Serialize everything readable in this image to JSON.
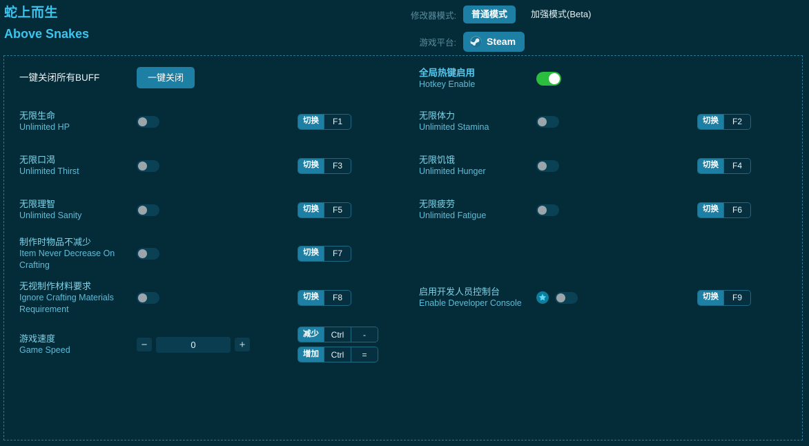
{
  "header": {
    "title_cn": "蛇上而生",
    "title_en": "Above Snakes",
    "mode_label": "修改器模式:",
    "mode_normal": "普通模式",
    "mode_enhanced": "加强模式(Beta)",
    "platform_label": "游戏平台:",
    "platform_value": "Steam",
    "platform_icon": "steam-icon"
  },
  "top_row": {
    "left_label_cn": "一键关闭所有BUFF",
    "close_all_button": "一键关闭",
    "hotkey_cn": "全局热键启用",
    "hotkey_en": "Hotkey Enable",
    "hotkey_state": "on"
  },
  "left_column": [
    {
      "cn": "无限生命",
      "en": "Unlimited HP",
      "toggle": "off",
      "hotkeys": [
        {
          "action": "切换",
          "keys": [
            "F1"
          ]
        }
      ]
    },
    {
      "cn": "无限口渴",
      "en": "Unlimited Thirst",
      "toggle": "off",
      "hotkeys": [
        {
          "action": "切换",
          "keys": [
            "F3"
          ]
        }
      ]
    },
    {
      "cn": "无限理智",
      "en": "Unlimited Sanity",
      "toggle": "off",
      "hotkeys": [
        {
          "action": "切换",
          "keys": [
            "F5"
          ]
        }
      ]
    },
    {
      "cn": "制作时物品不减少",
      "en": "Item Never Decrease On Crafting",
      "toggle": "off",
      "hotkeys": [
        {
          "action": "切换",
          "keys": [
            "F7"
          ]
        }
      ]
    },
    {
      "cn": "无视制作材料要求",
      "en": "Ignore Crafting Materials Requirement",
      "toggle": "off",
      "hotkeys": [
        {
          "action": "切换",
          "keys": [
            "F8"
          ]
        }
      ]
    },
    {
      "cn": "游戏速度",
      "en": "Game Speed",
      "control": "stepper",
      "value": "0",
      "minus": "−",
      "plus": "+",
      "hotkeys": [
        {
          "action": "减少",
          "keys": [
            "Ctrl",
            "-"
          ]
        },
        {
          "action": "增加",
          "keys": [
            "Ctrl",
            "="
          ]
        }
      ]
    }
  ],
  "right_column": [
    {
      "cn": "无限体力",
      "en": "Unlimited Stamina",
      "toggle": "off",
      "hotkeys": [
        {
          "action": "切换",
          "keys": [
            "F2"
          ]
        }
      ]
    },
    {
      "cn": "无限饥饿",
      "en": "Unlimited Hunger",
      "toggle": "off",
      "hotkeys": [
        {
          "action": "切换",
          "keys": [
            "F4"
          ]
        }
      ]
    },
    {
      "cn": "无限疲劳",
      "en": "Unlimited Fatigue",
      "toggle": "off",
      "hotkeys": [
        {
          "action": "切换",
          "keys": [
            "F6"
          ]
        }
      ]
    },
    {
      "cn": "启用开发人员控制台",
      "en": "Enable Developer Console",
      "toggle": "off",
      "badge": "star-icon",
      "hotkeys": [
        {
          "action": "切换",
          "keys": [
            "F9"
          ]
        }
      ]
    }
  ],
  "colors": {
    "background": "#032b38",
    "accent": "#1d7fa3",
    "title": "#3cc4ef",
    "label_cn": "#7fd4ea",
    "label_en": "#5fbcd8",
    "toggle_on": "#2bbd3e",
    "panel_border": "#2b7a95"
  }
}
